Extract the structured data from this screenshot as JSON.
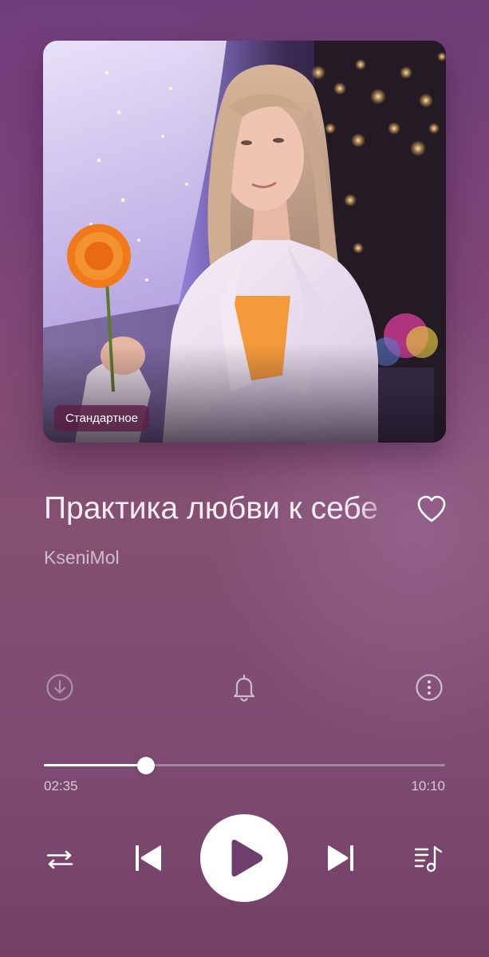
{
  "cover": {
    "quality_badge": "Стандартное"
  },
  "track": {
    "title": "Практика любви к себе",
    "artist": "KseniMol",
    "liked": false
  },
  "actions": {
    "download_icon": "download-circle-icon",
    "alarm_icon": "bell-icon",
    "more_icon": "more-vertical-circle-icon"
  },
  "playback": {
    "elapsed": "02:35",
    "total": "10:10",
    "progress_fraction": 0.2541,
    "state": "paused"
  },
  "controls": {
    "repeat_icon": "repeat-icon",
    "prev_icon": "skip-previous-icon",
    "play_icon": "play-icon",
    "next_icon": "skip-next-icon",
    "queue_icon": "playlist-music-icon"
  },
  "colors": {
    "accent": "#ffffff",
    "badge_bg": "#5a1e46"
  }
}
